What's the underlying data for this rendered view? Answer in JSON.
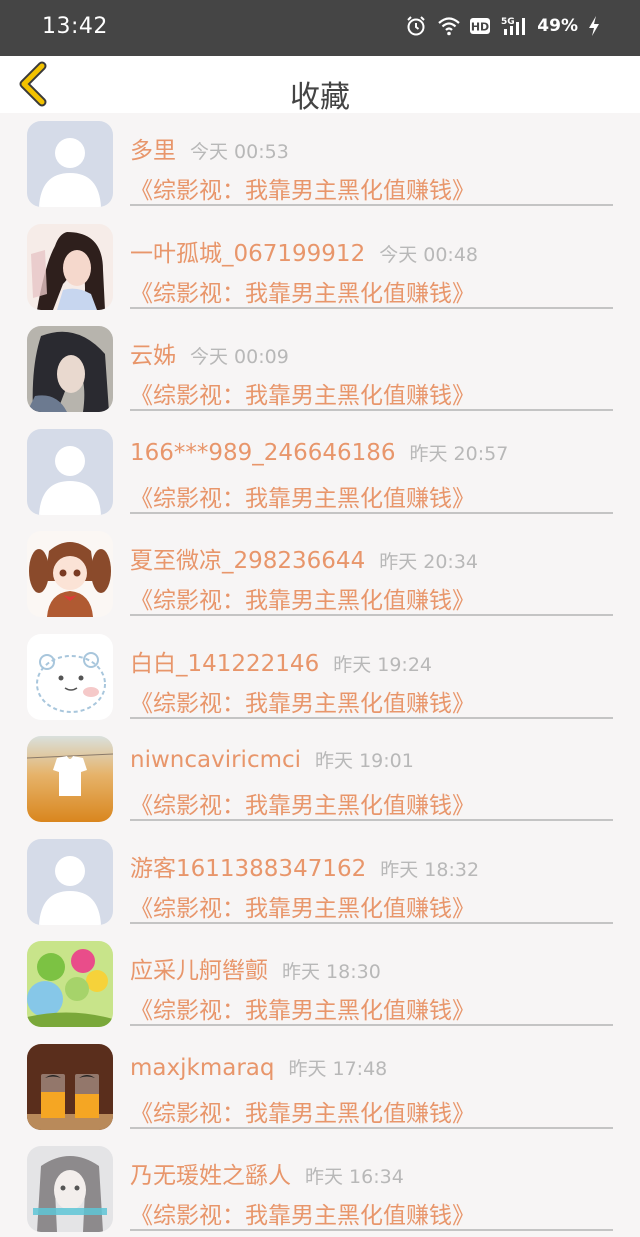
{
  "status_bar": {
    "time": "13:42",
    "battery": "49%",
    "icons": [
      "alarm-icon",
      "wifi-icon",
      "hd-icon",
      "5g-signal-icon",
      "charging-icon"
    ]
  },
  "header": {
    "title": "收藏",
    "back_icon": "chevron-left-icon",
    "accent": "#f2c200"
  },
  "colors": {
    "name": "#e8966b",
    "time": "#b8b8b8",
    "divider": "#c4c4c4"
  },
  "items": [
    {
      "name": "多里",
      "time": "今天 00:53",
      "book": "《综影视：我靠男主黑化值赚钱》",
      "avatar": "default-avatar"
    },
    {
      "name": "一叶孤城_067199912",
      "time": "今天 00:48",
      "book": "《综影视：我靠男主黑化值赚钱》",
      "avatar": "anime-girl-avatar"
    },
    {
      "name": "云姊",
      "time": "今天 00:09",
      "book": "《综影视：我靠男主黑化值赚钱》",
      "avatar": "anime-girl-dark-hair-avatar"
    },
    {
      "name": "166***989_246646186",
      "time": "昨天 20:57",
      "book": "《综影视：我靠男主黑化值赚钱》",
      "avatar": "default-avatar"
    },
    {
      "name": "夏至微凉_298236644",
      "time": "昨天 20:34",
      "book": "《综影视：我靠男主黑化值赚钱》",
      "avatar": "anime-girl-twintails-avatar"
    },
    {
      "name": "白白_141222146",
      "time": "昨天 19:24",
      "book": "《综影视：我靠男主黑化值赚钱》",
      "avatar": "cartoon-bear-avatar"
    },
    {
      "name": "niwncaviricmci",
      "time": "昨天 19:01",
      "book": "《综影视：我靠男主黑化值赚钱》",
      "avatar": "shirt-field-avatar"
    },
    {
      "name": "游客1611388347162",
      "time": "昨天 18:32",
      "book": "《综影视：我靠男主黑化值赚钱》",
      "avatar": "default-avatar"
    },
    {
      "name": "应采儿舸辔颤",
      "time": "昨天 18:30",
      "book": "《综影视：我靠男主黑化值赚钱》",
      "avatar": "balloons-avatar"
    },
    {
      "name": "maxjkmaraq",
      "time": "昨天 17:48",
      "book": "《综影视：我靠男主黑化值赚钱》",
      "avatar": "juice-glasses-avatar"
    },
    {
      "name": "乃无瑗姓之繇人",
      "time": "昨天 16:34",
      "book": "《综影视：我靠男主黑化值赚钱》",
      "avatar": "girl-portrait-avatar"
    }
  ]
}
